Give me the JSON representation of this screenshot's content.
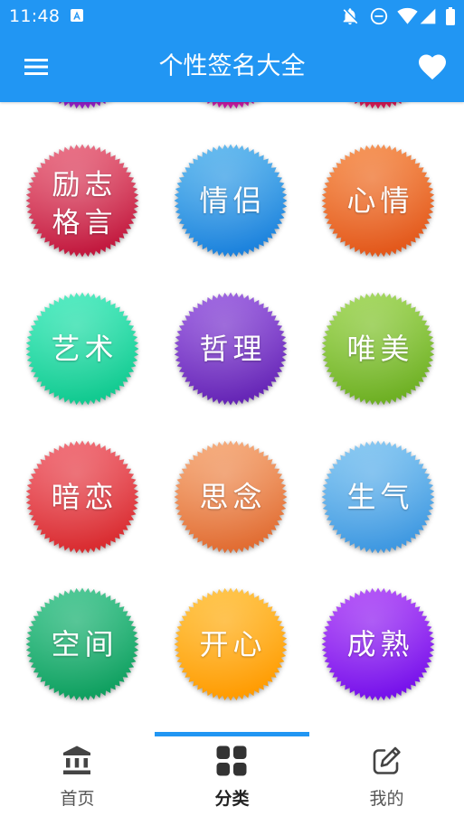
{
  "status_bar": {
    "time": "11:48",
    "icons": [
      "app-notification-icon",
      "notifications-off-icon",
      "do-not-disturb-icon",
      "wifi-icon",
      "signal-icon",
      "battery-icon"
    ]
  },
  "app_bar": {
    "title": "个性签名大全",
    "menu_icon": "menu-icon",
    "action_icon": "favorite-icon"
  },
  "colors": {
    "primary": "#2196F3",
    "badge_text": "#FFFFFF",
    "tab_text": "#555555",
    "tab_selected_text": "#222222"
  },
  "categories": {
    "scrolled_off": [
      {
        "color_top": "#b03ed0",
        "color_bottom": "#8e1cc0"
      },
      {
        "color_top": "#d434b8",
        "color_bottom": "#c0189c"
      },
      {
        "color_top": "#e2406e",
        "color_bottom": "#cc1650"
      }
    ],
    "items": [
      {
        "lines": [
          "励志",
          "格言"
        ],
        "color_top": "#e65c74",
        "color_bottom": "#c0163c"
      },
      {
        "lines": [
          "情侣"
        ],
        "color_top": "#4eb0ec",
        "color_bottom": "#1a80dc"
      },
      {
        "lines": [
          "心情"
        ],
        "color_top": "#f4843e",
        "color_bottom": "#e2561a"
      },
      {
        "lines": [
          "艺术"
        ],
        "color_top": "#3ae8b8",
        "color_bottom": "#10c88e"
      },
      {
        "lines": [
          "哲理"
        ],
        "color_top": "#9050dc",
        "color_bottom": "#6424b4"
      },
      {
        "lines": [
          "唯美"
        ],
        "color_top": "#98d24a",
        "color_bottom": "#6cae22"
      },
      {
        "lines": [
          "暗恋"
        ],
        "color_top": "#ee5a64",
        "color_bottom": "#d82a2e"
      },
      {
        "lines": [
          "思念"
        ],
        "color_top": "#f4a06a",
        "color_bottom": "#e06a30"
      },
      {
        "lines": [
          "生气"
        ],
        "color_top": "#76c0f0",
        "color_bottom": "#3c96e0"
      },
      {
        "lines": [
          "空间"
        ],
        "color_top": "#34c086",
        "color_bottom": "#0e9e5e"
      },
      {
        "lines": [
          "开心"
        ],
        "color_top": "#ffbc30",
        "color_bottom": "#ff9a00"
      },
      {
        "lines": [
          "成熟"
        ],
        "color_top": "#a83cf6",
        "color_bottom": "#7410ea"
      }
    ]
  },
  "bottom_nav": {
    "selected_index": 1,
    "tabs": [
      {
        "label": "首页",
        "icon": "bank-icon"
      },
      {
        "label": "分类",
        "icon": "grid-icon"
      },
      {
        "label": "我的",
        "icon": "edit-icon"
      }
    ]
  }
}
